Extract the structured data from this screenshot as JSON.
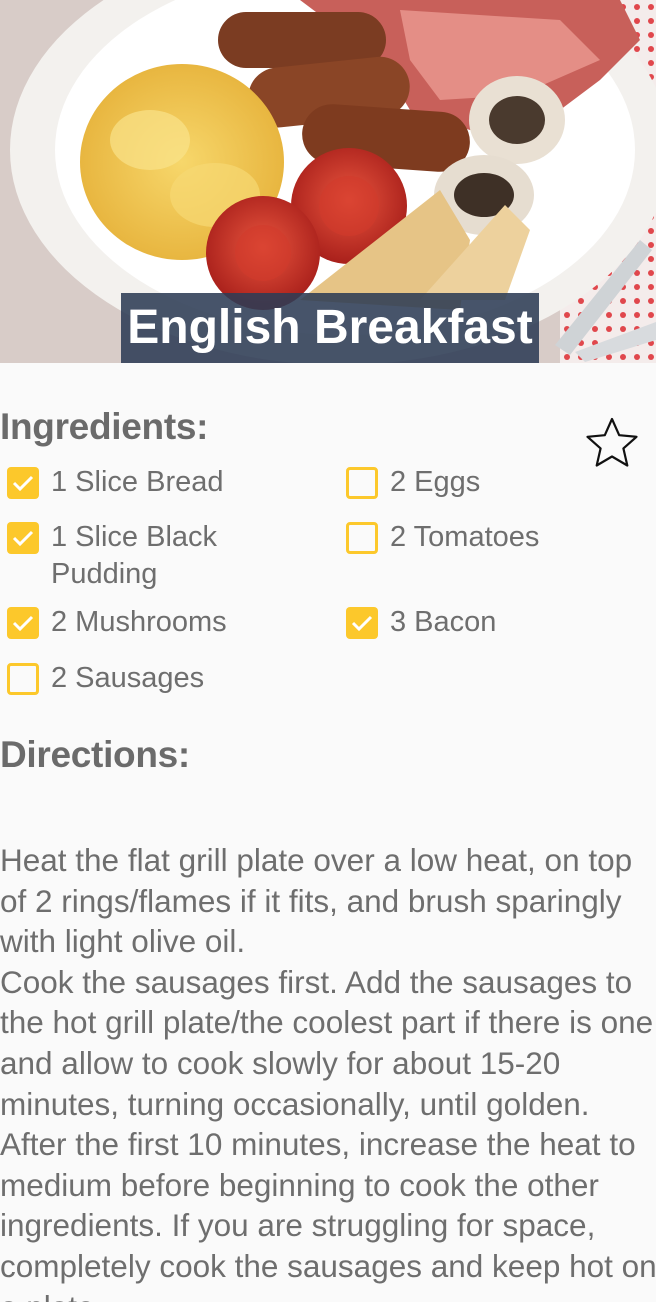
{
  "recipe": {
    "title": "English Breakfast",
    "favorite": false
  },
  "ingredients": {
    "heading": "Ingredients:",
    "items": [
      {
        "label": "1 Slice Bread",
        "checked": true
      },
      {
        "label": "2 Eggs",
        "checked": false
      },
      {
        "label": "1 Slice Black Pudding",
        "checked": true
      },
      {
        "label": "2 Tomatoes",
        "checked": false
      },
      {
        "label": "2 Mushrooms",
        "checked": true
      },
      {
        "label": "3 Bacon",
        "checked": true
      },
      {
        "label": "2 Sausages",
        "checked": false
      }
    ]
  },
  "directions": {
    "heading": "Directions:",
    "text": "Heat the flat grill plate over a low heat, on top of 2 rings/flames if it fits, and brush sparingly with light olive oil.\nCook the sausages first. Add the sausages to the hot grill plate/the coolest part if there is one and allow to cook slowly for about 15-20 minutes, turning occasionally, until golden. After the first 10 minutes, increase the heat to medium before beginning to cook the other ingredients. If you are struggling for space, completely cook the sausages and keep hot on a plate"
  },
  "icons": {
    "favorite": "star-outline-icon",
    "checkbox_checked": "check-icon"
  },
  "colors": {
    "accent": "#fcc82b",
    "text": "#6e6e6e",
    "heading": "#6b6b6b",
    "title_bg": "#2d3c55"
  }
}
